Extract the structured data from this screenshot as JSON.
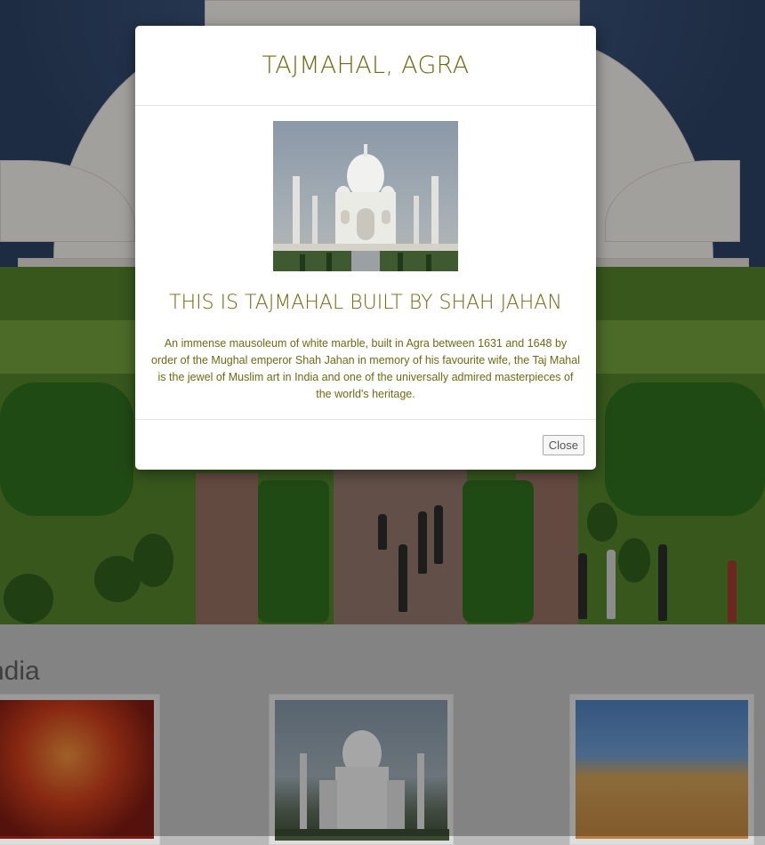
{
  "modal": {
    "title": "TAJMAHAL, AGRA",
    "subtitle": "THIS IS TAJMAHAL BUILT BY SHAH JAHAN",
    "description": "An immense mausoleum of white marble, built in Agra between 1631 and 1648 by order of the Mughal emperor Shah Jahan in memory of his favourite wife, the Taj Mahal is the jewel of Muslim art in India and one of the universally admired masterpieces of the world's heritage.",
    "close_label": "Close",
    "image": "taj-mahal-photo"
  },
  "background": {
    "hero_image": "lotus-temple-photo",
    "section_title": "ndia",
    "gallery": [
      {
        "image": "ganesha-idol-photo"
      },
      {
        "image": "taj-mahal-photo"
      },
      {
        "image": "rajasthan-palace-photo"
      }
    ]
  },
  "colors": {
    "accent_text": "#6b6b14",
    "overlay": "rgba(0,0,0,0.3)"
  }
}
